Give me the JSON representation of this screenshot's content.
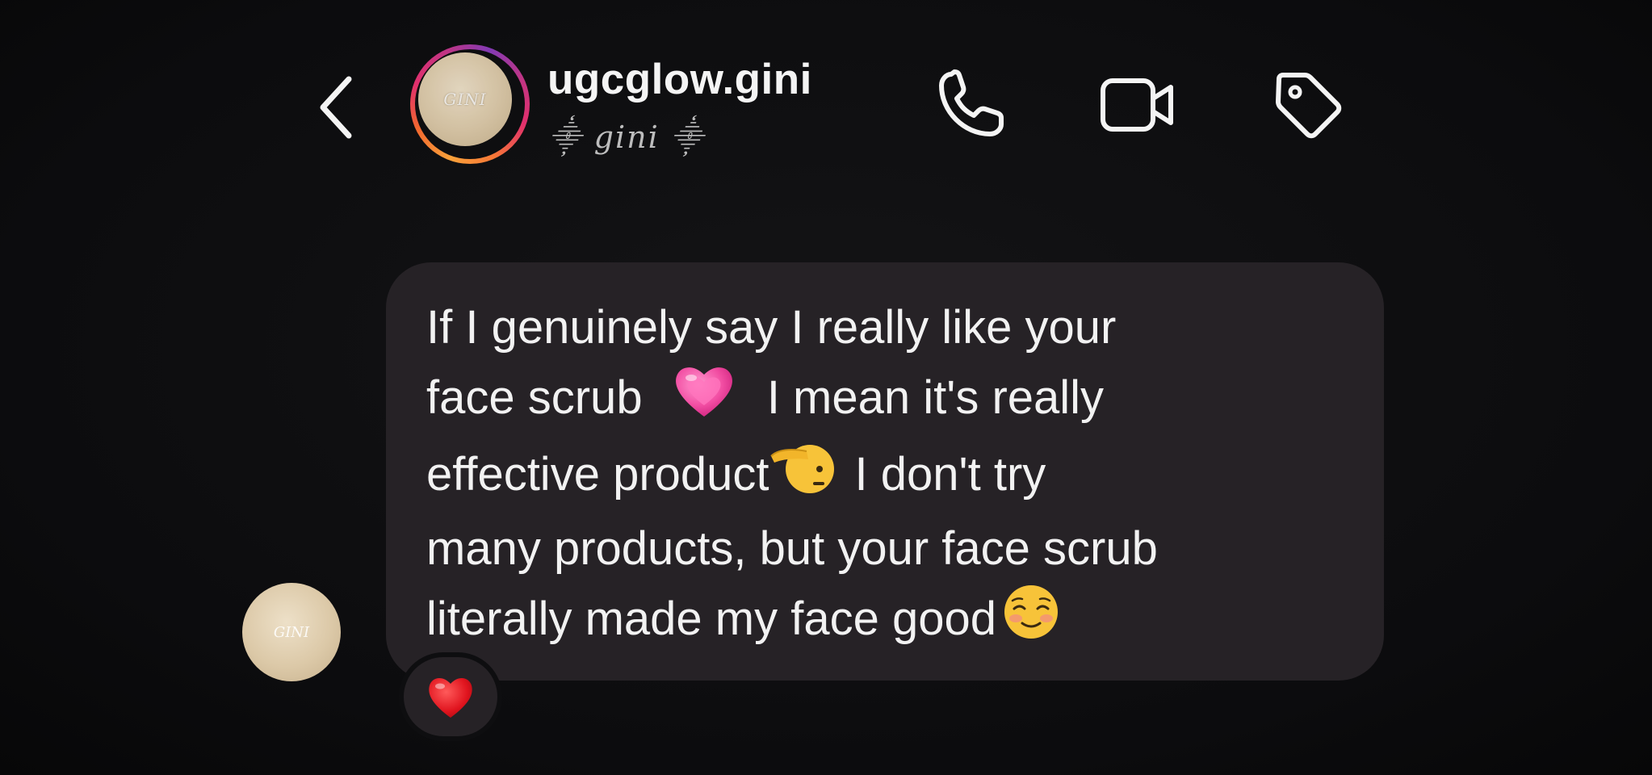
{
  "header": {
    "username": "ugcglow.gini",
    "display_name": "⸎ gini ⸎",
    "avatar_text": "GINI",
    "icons": [
      "back-chevron-icon",
      "phone-icon",
      "video-camera-icon",
      "tag-icon"
    ]
  },
  "message": {
    "lines": [
      "If I genuinely say I really like your",
      "face scrub",
      "I mean it's really",
      "effective product",
      "I don't try",
      "many products, but your face scrub",
      "literally made my face good"
    ],
    "emojis": [
      "growing-heart-emoji",
      "saluting-face-emoji",
      "smiling-face-emoji"
    ],
    "sender_avatar_text": "GINI"
  },
  "reaction": {
    "emoji": "red-heart-emoji"
  },
  "colors": {
    "background": "#0e0e10",
    "bubble": "#262226",
    "text": "#f2f2f2",
    "story_ring": [
      "#f9a13a",
      "#e1306c",
      "#833ab4"
    ]
  }
}
